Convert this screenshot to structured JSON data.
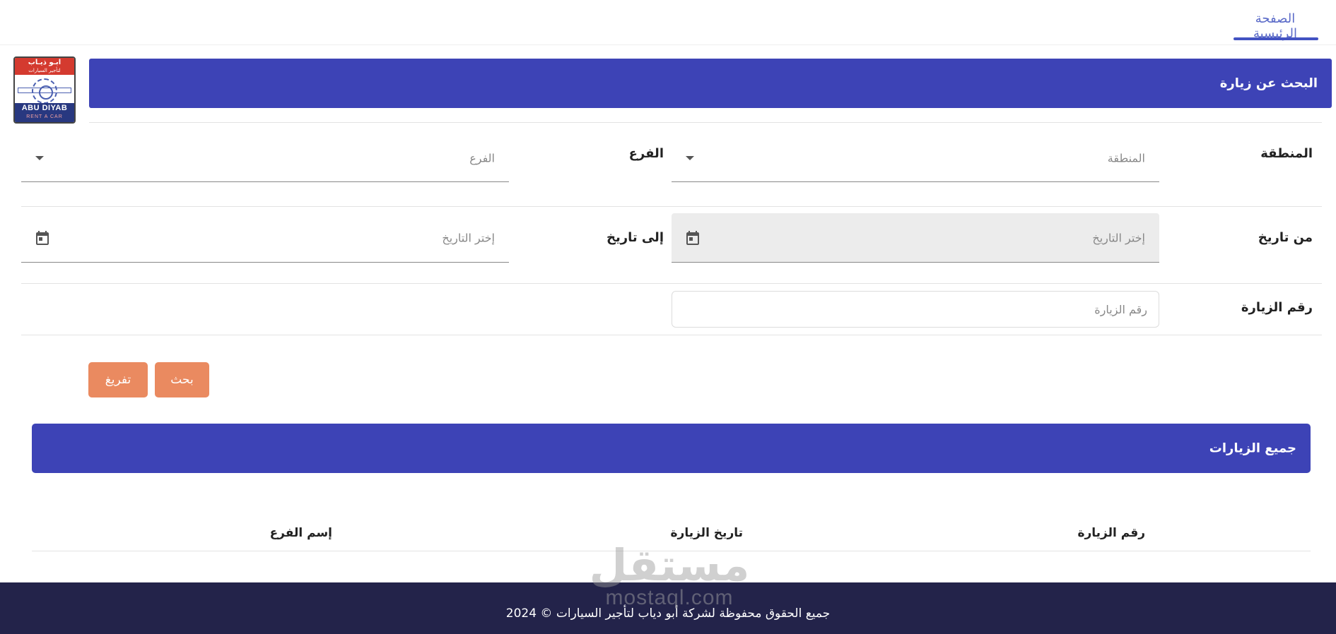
{
  "nav": {
    "home_tab": "الصفحة الرئيسية"
  },
  "logo": {
    "arabic_name": "ابـو ذيـاب",
    "arabic_sub": "لتأجير السيارات",
    "english_name": "ABU DIYAB",
    "english_sub": "RENT A CAR"
  },
  "search_section": {
    "title": "البحث عن زيارة",
    "region_label": "المنطقة",
    "region_placeholder": "المنطقة",
    "branch_label": "الفرع",
    "branch_placeholder": "الفرع",
    "from_date_label": "من تاريخ",
    "from_date_placeholder": "إختر التاريخ",
    "to_date_label": "إلى تاريخ",
    "to_date_placeholder": "إختر التاريخ",
    "visit_number_label": "رقم الزيارة",
    "visit_number_placeholder": "رقم الزيارة",
    "search_button": "بحث",
    "clear_button": "تفريغ"
  },
  "visits_section": {
    "title": "جميع الزيارات",
    "columns": [
      "رقم الزيارة",
      "تاريخ الزيارة",
      "إسم الفرع"
    ]
  },
  "footer": {
    "copyright": "جميع الحقوق محفوظة لشركة أبو دياب لتأجير السيارات © 2024"
  },
  "watermark": {
    "arabic": "مستقل",
    "english": "mostaql.com"
  },
  "colors": {
    "primary": "#3d43b6",
    "accent_button": "#ea8a60",
    "nav_active": "#4252c2",
    "footer_bg": "#23234a"
  },
  "icons": {
    "dropdown": "caret-down-icon",
    "date": "calendar-icon"
  }
}
